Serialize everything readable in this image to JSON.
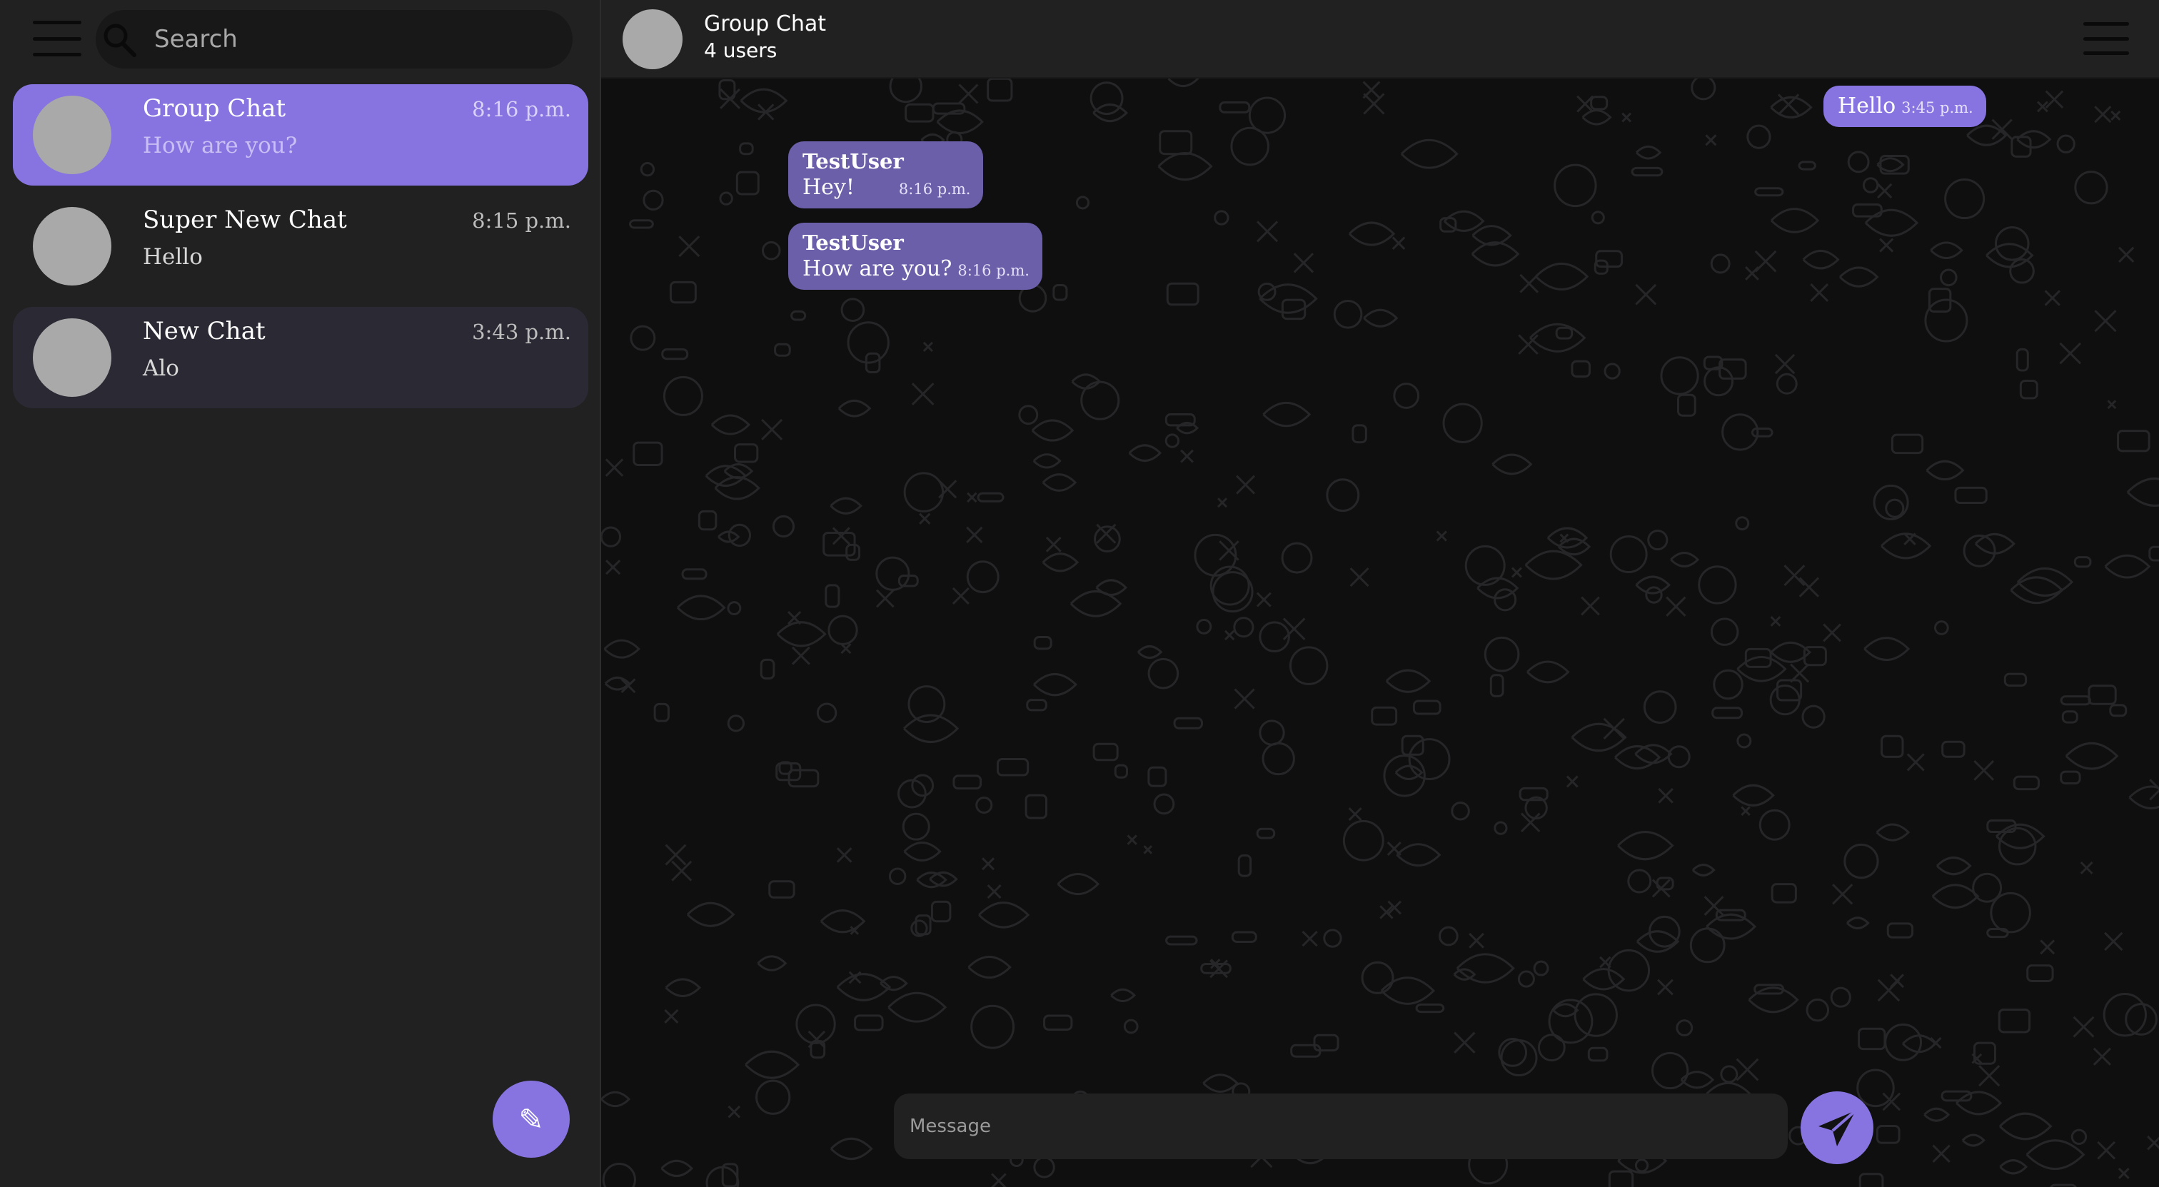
{
  "sidebar": {
    "search": {
      "placeholder": "Search"
    },
    "chats": [
      {
        "name": "Group Chat",
        "preview": "How are you?",
        "time": "8:16 p.m.",
        "state": "active"
      },
      {
        "name": "Super New Chat",
        "preview": "Hello",
        "time": "8:15 p.m.",
        "state": "default"
      },
      {
        "name": "New Chat",
        "preview": "Alo",
        "time": "3:43 p.m.",
        "state": "hover"
      }
    ],
    "compose_icon": "pencil-icon"
  },
  "header": {
    "title": "Group Chat",
    "subtitle": "4 users",
    "menu_icon": "hamburger-icon"
  },
  "messages": [
    {
      "direction": "outgoing",
      "sender": "",
      "text": "Hello",
      "time": "3:45 p.m."
    },
    {
      "direction": "incoming",
      "sender": "TestUser",
      "text": "Hey!",
      "time": "8:16 p.m."
    },
    {
      "direction": "incoming",
      "sender": "TestUser",
      "text": "How are you?",
      "time": "8:16 p.m."
    }
  ],
  "composer": {
    "placeholder": "Message",
    "send_icon": "paper-plane-icon"
  },
  "colors": {
    "accent": "#8774e1",
    "incoming_bubble": "#6a5fa8",
    "panel": "#212121",
    "chat_background": "#0f0f10",
    "avatar": "#a9a9a9"
  }
}
